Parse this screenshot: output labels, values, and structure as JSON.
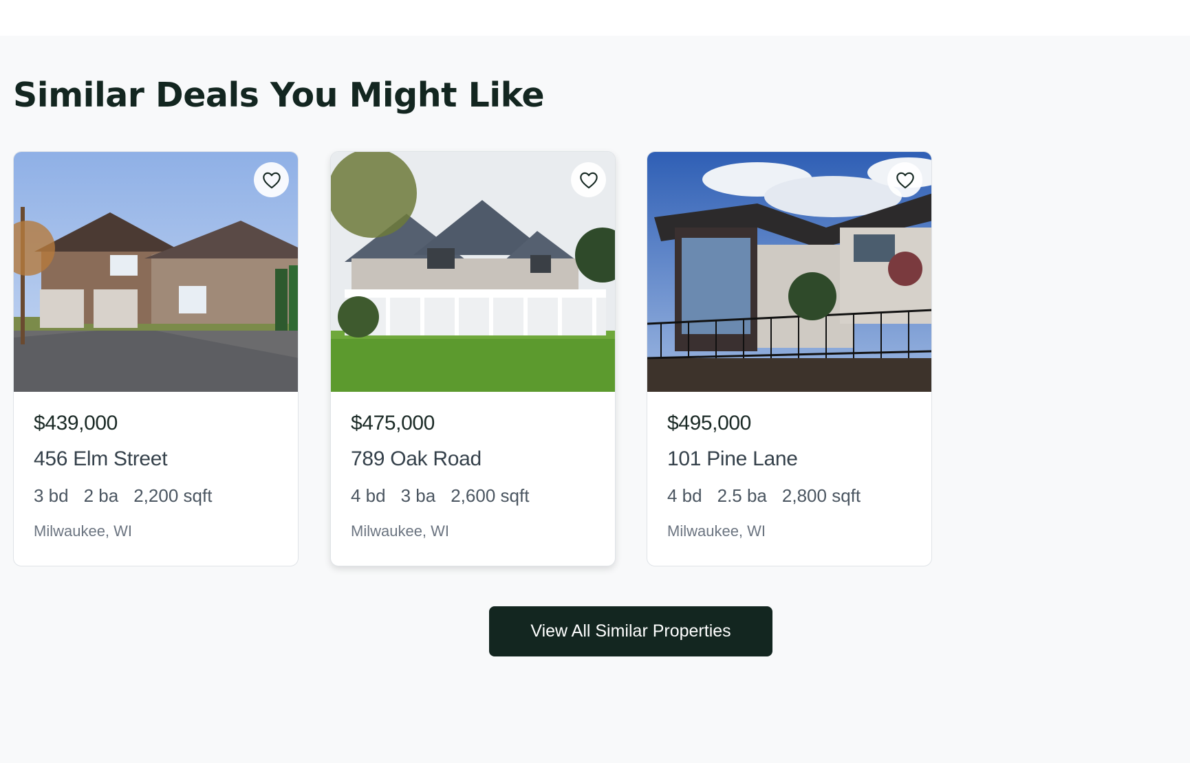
{
  "section": {
    "title": "Similar Deals You Might Like",
    "view_all_label": "View All Similar Properties"
  },
  "listings": [
    {
      "price": "$439,000",
      "address": "456 Elm Street",
      "beds": "3 bd",
      "baths": "2 ba",
      "sqft": "2,200 sqft",
      "location": "Milwaukee, WI",
      "favorite_icon": "heart-outline-icon"
    },
    {
      "price": "$475,000",
      "address": "789 Oak Road",
      "beds": "4 bd",
      "baths": "3 ba",
      "sqft": "2,600 sqft",
      "location": "Milwaukee, WI",
      "favorite_icon": "heart-outline-icon"
    },
    {
      "price": "$495,000",
      "address": "101 Pine Lane",
      "beds": "4 bd",
      "baths": "2.5 ba",
      "sqft": "2,800 sqft",
      "location": "Milwaukee, WI",
      "favorite_icon": "heart-outline-icon"
    }
  ],
  "colors": {
    "primary_dark": "#132620",
    "section_bg": "#f8f9fa",
    "card_border": "#dfe3e7"
  }
}
